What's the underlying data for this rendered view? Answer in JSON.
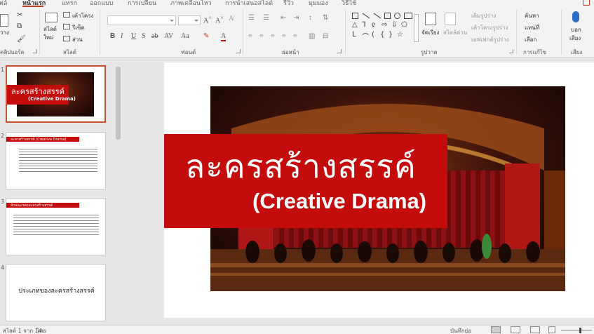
{
  "tabs": [
    {
      "label": "ไฟล์"
    },
    {
      "label": "หน้าแรก",
      "active": true
    },
    {
      "label": "แทรก"
    },
    {
      "label": "ออกแบบ"
    },
    {
      "label": "การเปลี่ยน"
    },
    {
      "label": "ภาพเคลื่อนไหว"
    },
    {
      "label": "การนำเสนอสไลด์"
    },
    {
      "label": "รีวิว"
    },
    {
      "label": "มุมมอง"
    },
    {
      "label": "วิธีใช้"
    }
  ],
  "ribbon": {
    "clipboard": {
      "paste_label": "วาง",
      "group_label": "คลิปบอร์ด"
    },
    "slides": {
      "new_slide_label": "สไลด์ใหม่",
      "layout_label": "เค้าโครง",
      "reset_label": "รีเซ็ต",
      "section_label": "ส่วน",
      "group_label": "สไลด์"
    },
    "font": {
      "font_name": "",
      "font_size": "",
      "group_label": "ฟอนต์"
    },
    "paragraph": {
      "group_label": "ย่อหน้า"
    },
    "drawing": {
      "arrange_label": "จัดเรียง",
      "quick_styles_label": "สไตล์ด่วน",
      "fill_label": "เติมรูปร่าง",
      "outline_label": "เค้าโครงรูปร่าง",
      "effects_label": "เอฟเฟกต์รูปร่าง",
      "group_label": "รูปวาด"
    },
    "editing": {
      "find_label": "ค้นหา",
      "replace_label": "แทนที่",
      "select_label": "เลือก",
      "group_label": "การแก้ไข"
    },
    "voice": {
      "dictate_label": "บอก",
      "dictate_label2": "เสียง",
      "group_label": "เสียง"
    }
  },
  "thumbnails": [
    {
      "number": "1",
      "title": "ละครสร้างสรรค์",
      "subtitle": "(Creative Drama)"
    },
    {
      "number": "2",
      "heading": "ละครสร้างสรรค์ (Creative Drama)"
    },
    {
      "number": "3",
      "heading": "ลักษณะของละครสร้างสรรค์"
    },
    {
      "number": "4",
      "text": "ประเภทของละครสร้างสรรค์"
    }
  ],
  "slide": {
    "title_thai": "ละครสร้างสรรค์",
    "title_english": "(Creative Drama)"
  },
  "status": {
    "slide_counter": "สไลด์ 1 จาก 14",
    "language": "ไทย",
    "notes_label": "บันทึกย่อ"
  },
  "colors": {
    "accent": "#c43e1c",
    "title_box": "#c40c0c",
    "selected_thumb_border": "#c9532c"
  }
}
